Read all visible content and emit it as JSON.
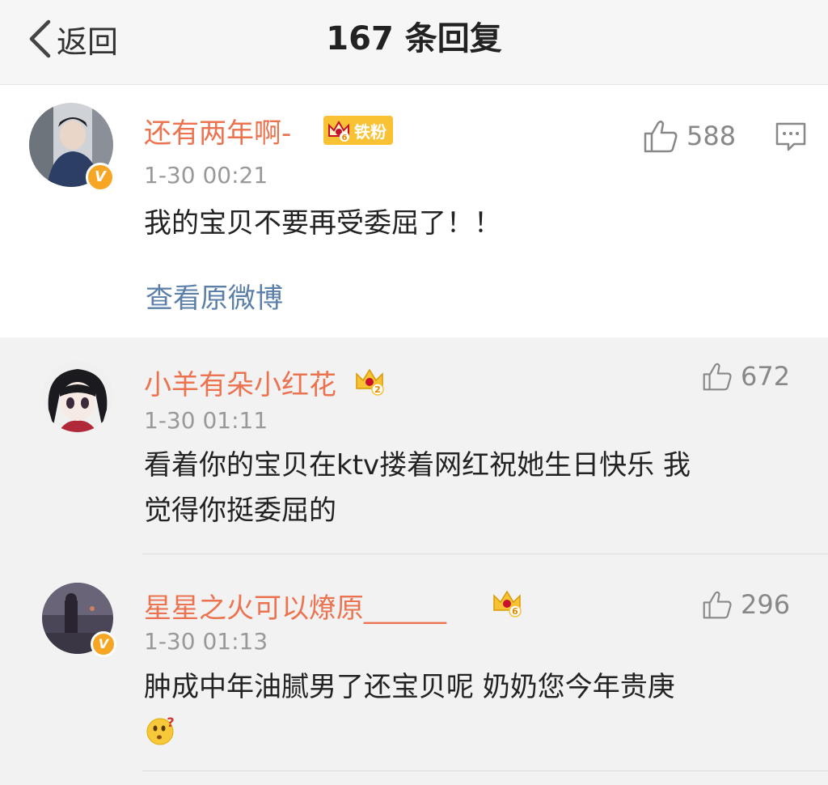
{
  "header": {
    "back_label": "返回",
    "title": "167 条回复"
  },
  "main_comment": {
    "username": "还有两年啊-",
    "fan_badge": "铁粉",
    "fan_level": "6",
    "time": "1-30 00:21",
    "text": "我的宝贝不要再受委屈了！！",
    "likes": "588",
    "view_original": "查看原微博"
  },
  "replies": [
    {
      "username": "小羊有朵小红花",
      "crown_level": "2",
      "time": "1-30 01:11",
      "text_line1": "看着你的宝贝在ktv搂着网红祝她生日快乐 我",
      "text_line2": "觉得你挺委屈的",
      "likes": "672"
    },
    {
      "username": "星星之火可以燎原______",
      "crown_level": "6",
      "time": "1-30 01:13",
      "text_line1": "肿成中年油腻男了还宝贝呢 奶奶您今年贵庚",
      "likes": "296"
    }
  ],
  "colors": {
    "username": "#eb7350",
    "link": "#5b7fa8",
    "badge": "#f8c234",
    "verified": "#f6a623"
  },
  "icons": [
    "back-chevron-icon",
    "thumbs-up-icon",
    "comment-icon",
    "crown-icon",
    "verified-icon",
    "thinking-emoji-icon"
  ]
}
